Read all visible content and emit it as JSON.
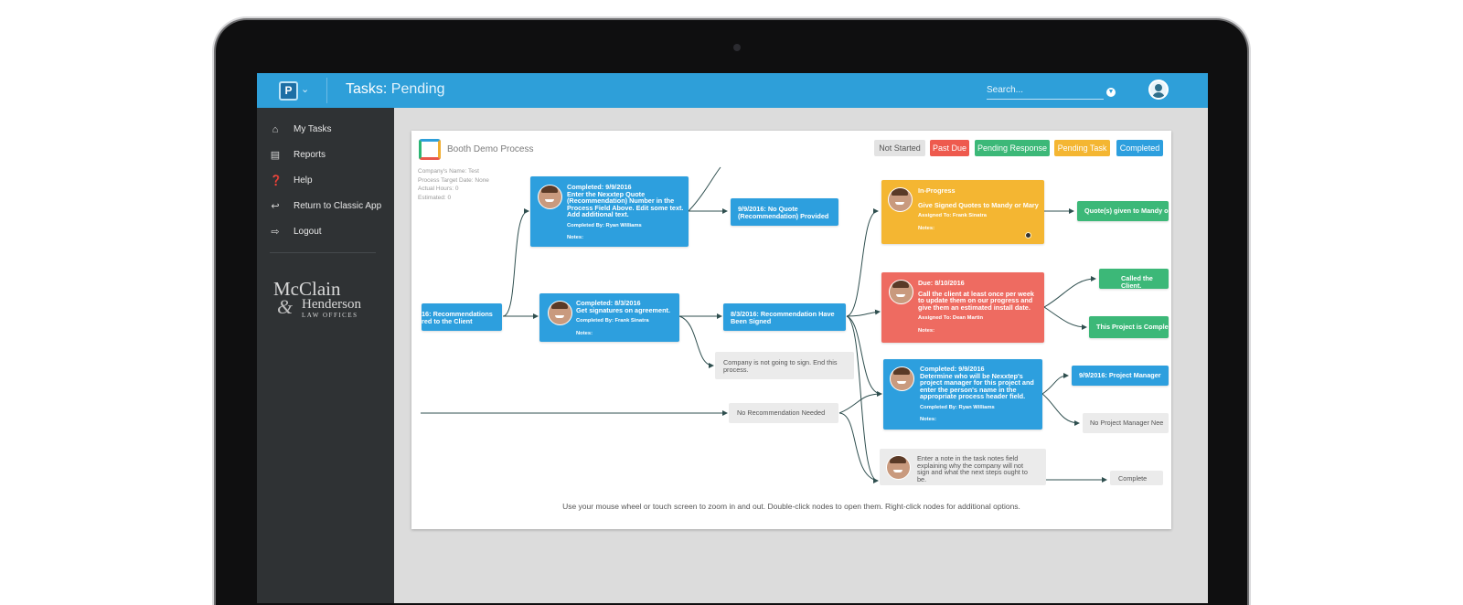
{
  "topbar": {
    "logo_letter": "P",
    "title_prefix": "Tasks:",
    "title_value": "Pending",
    "search_placeholder": "Search..."
  },
  "sidebar": {
    "items": [
      {
        "label": "My Tasks",
        "icon": "home-icon"
      },
      {
        "label": "Reports",
        "icon": "bar-chart-icon"
      },
      {
        "label": "Help",
        "icon": "question-icon"
      },
      {
        "label": "Return to Classic App",
        "icon": "arrow-left-icon"
      },
      {
        "label": "Logout",
        "icon": "logout-icon"
      }
    ],
    "brand": {
      "line1": "McClain",
      "amp": "&",
      "line2": "Henderson",
      "line3": "LAW OFFICES"
    }
  },
  "process": {
    "title": "Booth Demo Process",
    "meta": [
      "Company's Name: Test",
      "Process Target Date: None",
      "Actual Hours: 0",
      "Estimated: 0"
    ]
  },
  "legend": [
    {
      "label": "Not Started",
      "color": "#e3e3e3"
    },
    {
      "label": "Past Due",
      "color": "#ee5a4e"
    },
    {
      "label": "Pending Response",
      "color": "#3cb878"
    },
    {
      "label": "Pending Task",
      "color": "#f4b632"
    },
    {
      "label": "Completed",
      "color": "#2d9fde"
    }
  ],
  "nodes": {
    "recommendations": {
      "line1": "16: Recommendations",
      "line2": "red to the Client"
    },
    "quote": {
      "line1": "Completed: 9/9/2016",
      "line2": "Enter the Nexxtep Quote",
      "line3": "(Recommendation) Number in the",
      "line4": "Process Field Above. Edit some text.",
      "line5": "Add additional text.",
      "by": "Completed By: Ryan Williams",
      "notes": "Notes:"
    },
    "no_quote": {
      "line1": "9/9/2016: No Quote",
      "line2": "(Recommendation) Provided"
    },
    "signatures": {
      "line1": "Completed: 8/3/2016",
      "line2": "Get signatures on agreement.",
      "by": "Completed By: Frank Sinatra",
      "notes": "Notes:"
    },
    "signed": {
      "line1": "8/3/2016: Recommendation Have",
      "line2": "Been Signed"
    },
    "not_sign": {
      "line1": "Company is not going to sign.  End this",
      "line2": "process."
    },
    "no_rec": {
      "line1": "No Recommendation Needed"
    },
    "in_progress": {
      "line1": "In-Progress",
      "line2": "Give Signed Quotes to Mandy or Mary",
      "by": "Assigned To: Frank Sinatra",
      "notes": "Notes:"
    },
    "quotes_given": {
      "line1": "Quote(s) given to Mandy o"
    },
    "due": {
      "line1": "Due: 8/10/2016",
      "line2": "Call the client at least once per week",
      "line3": "to update them on our progress and",
      "line4": "give them an estimated install date.",
      "by": "Assigned To: Dean Martin",
      "notes": "Notes:"
    },
    "called": {
      "line1": "Called the Client."
    },
    "project_complete": {
      "line1": "This Project is Comple"
    },
    "determine": {
      "line1": "Completed: 9/9/2016",
      "line2": "Determine who will be Nexxtep's",
      "line3": "project manager for this project and",
      "line4": "enter the person's name in the",
      "line5": "appropriate process header field.",
      "by": "Completed By: Ryan Williams",
      "notes": "Notes:"
    },
    "pm": {
      "line1": "9/9/2016: Project Manager"
    },
    "no_pm": {
      "line1": "No Project Manager Nee"
    },
    "enter_note": {
      "line1": "Enter a note in the task notes field",
      "line2": "explaining why the company will not",
      "line3": "sign and what the next steps ought to",
      "line4": "be."
    },
    "complete": {
      "line1": "Complete"
    }
  },
  "hint": "Use your mouse wheel or touch screen to zoom in and out. Double-click nodes to open them. Right-click nodes for additional options."
}
